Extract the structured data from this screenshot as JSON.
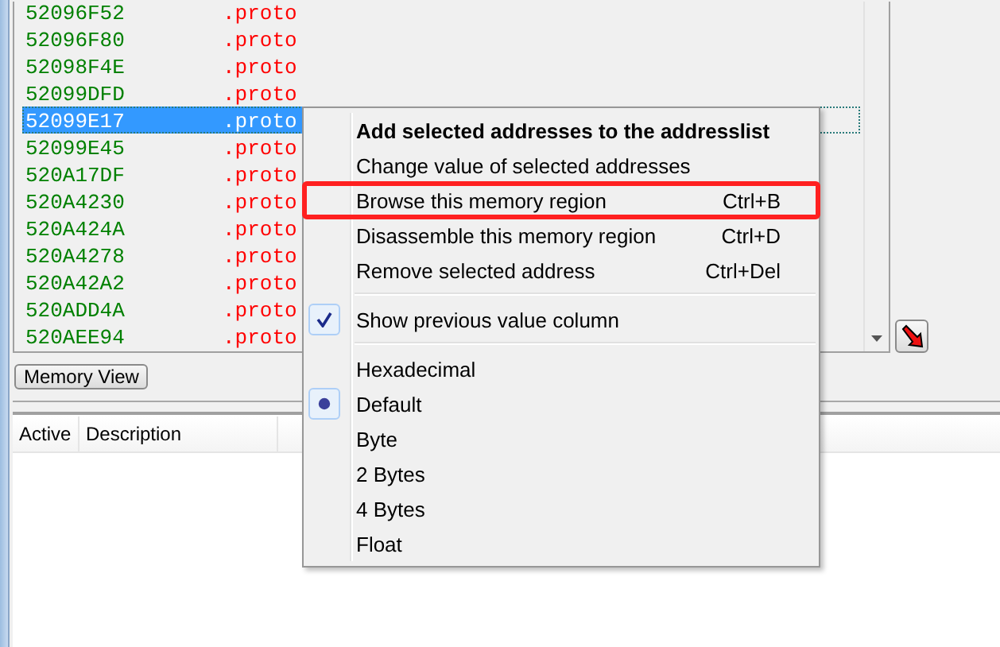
{
  "results": [
    {
      "address": "52096F52",
      "value": ".proto",
      "selected": false
    },
    {
      "address": "52096F80",
      "value": ".proto",
      "selected": false
    },
    {
      "address": "52098F4E",
      "value": ".proto",
      "selected": false
    },
    {
      "address": "52099DFD",
      "value": ".proto",
      "selected": false
    },
    {
      "address": "52099E17",
      "value": ".proto",
      "selected": true
    },
    {
      "address": "52099E45",
      "value": ".proto",
      "selected": false
    },
    {
      "address": "520A17DF",
      "value": ".proto",
      "selected": false
    },
    {
      "address": "520A4230",
      "value": ".proto",
      "selected": false
    },
    {
      "address": "520A424A",
      "value": ".proto",
      "selected": false
    },
    {
      "address": "520A4278",
      "value": ".proto",
      "selected": false
    },
    {
      "address": "520A42A2",
      "value": ".proto",
      "selected": false
    },
    {
      "address": "520ADD4A",
      "value": ".proto",
      "selected": false
    },
    {
      "address": "520AEE94",
      "value": ".proto",
      "selected": false
    }
  ],
  "memory_view_button": "Memory View",
  "address_list": {
    "columns": [
      "Active",
      "Description"
    ]
  },
  "context_menu": [
    {
      "kind": "command",
      "label": "Add selected addresses to the addresslist",
      "bold": true,
      "highlighted": false
    },
    {
      "kind": "command",
      "label": "Change value of selected addresses",
      "bold": false,
      "highlighted": false
    },
    {
      "kind": "command",
      "label": "Browse this memory region",
      "shortcut": "Ctrl+B",
      "bold": false,
      "highlighted": true
    },
    {
      "kind": "command",
      "label": "Disassemble this memory region",
      "shortcut": "Ctrl+D",
      "bold": false,
      "highlighted": false
    },
    {
      "kind": "command",
      "label": "Remove selected address",
      "shortcut": "Ctrl+Del",
      "bold": false,
      "highlighted": false
    },
    {
      "kind": "separator"
    },
    {
      "kind": "check",
      "label": "Show previous value column",
      "checked": true
    },
    {
      "kind": "separator"
    },
    {
      "kind": "radio",
      "label": "Hexadecimal",
      "selected": false
    },
    {
      "kind": "radio",
      "label": "Default",
      "selected": true
    },
    {
      "kind": "radio",
      "label": "Byte",
      "selected": false
    },
    {
      "kind": "radio",
      "label": "2 Bytes",
      "selected": false
    },
    {
      "kind": "radio",
      "label": "4 Bytes",
      "selected": false
    },
    {
      "kind": "radio",
      "label": "Float",
      "selected": false
    }
  ]
}
